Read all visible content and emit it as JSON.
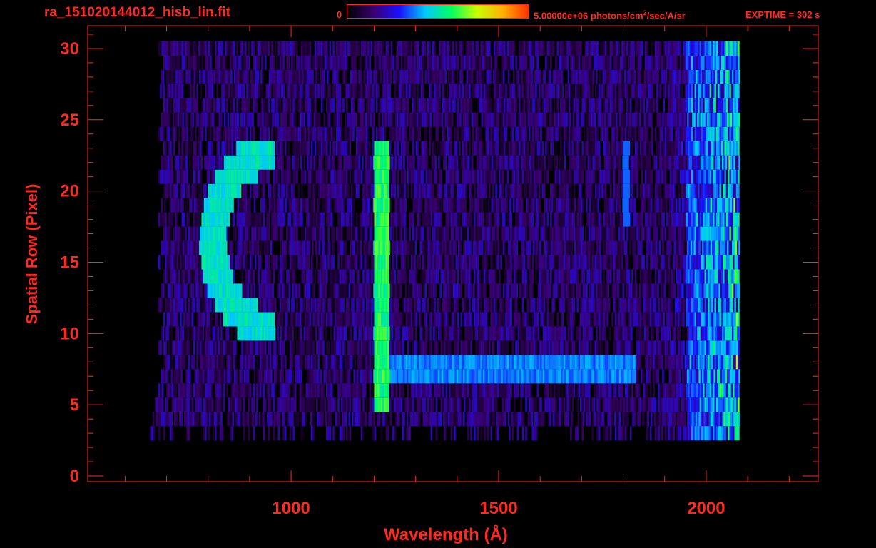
{
  "header": {
    "file_title": "ra_151020144012_hisb_lin.fit",
    "colorbar_min": "0",
    "colorbar_max": "5.00000e+06 photons/cm",
    "colorbar_unit_sup": "2",
    "colorbar_unit_rest": "/sec/A/sr",
    "exptime": "EXPTIME = 302 s"
  },
  "colors": {
    "axis": "#ff2a1f",
    "background": "#000000",
    "colormap": [
      "#000000",
      "#3a0070",
      "#1a10ff",
      "#00c8ff",
      "#00ff60",
      "#c8ff00",
      "#ffb000",
      "#ff3000"
    ]
  },
  "chart_data": {
    "type": "heatmap",
    "title": "ra_151020144012_hisb_lin.fit",
    "xlabel": "Wavelength (Å)",
    "ylabel": "Spatial Row (Pixel)",
    "xlim": [
      510,
      2270
    ],
    "ylim": [
      -0.4,
      31.6
    ],
    "x_ticks": [
      1000,
      1500,
      2000
    ],
    "y_ticks": [
      0,
      5,
      10,
      15,
      20,
      25,
      30
    ],
    "x_tick_labels": [
      "1000",
      "1500",
      "2000"
    ],
    "y_tick_labels": [
      "0",
      "5",
      "10",
      "15",
      "20",
      "25",
      "30"
    ],
    "color_range": [
      0,
      5000000
    ],
    "color_unit": "photons/cm^2/sec/A/sr",
    "exptime_s": 302,
    "data_extent": {
      "wavelength": [
        680,
        2080
      ],
      "rows": [
        3,
        30
      ]
    },
    "features": [
      {
        "name": "Lyman-alpha",
        "wavelength": 1216,
        "rows": [
          5,
          23
        ],
        "level": 0.55
      },
      {
        "name": "arc feature",
        "wavelength_range": [
          780,
          960
        ],
        "rows": [
          10,
          23
        ],
        "level": 0.5
      },
      {
        "name": "horizontal band",
        "wavelength_range": [
          1216,
          1830
        ],
        "rows": [
          7,
          9
        ],
        "level": 0.35
      },
      {
        "name": "long-wavelength edge",
        "wavelength_range": [
          1950,
          2065
        ],
        "rows": [
          1,
          30
        ],
        "level": 0.45
      }
    ]
  }
}
